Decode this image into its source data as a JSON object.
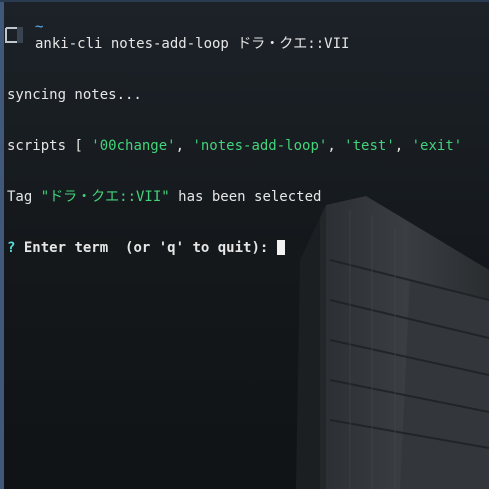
{
  "prompt": {
    "dir": "~",
    "command": "anki-cli notes-add-loop ドラ・クエ::VII"
  },
  "output": {
    "syncing": "syncing notes...",
    "scripts_prefix": "scripts [ ",
    "scripts": [
      "'00change'",
      "'notes-add-loop'",
      "'test'",
      "'exit'"
    ],
    "tag_prefix": "Tag ",
    "tag_name": "\"ドラ・クエ::VII\"",
    "tag_suffix": " has been selected",
    "question_mark": "?",
    "question_text": "Enter term  (or 'q' to quit):"
  },
  "colors": {
    "accent_green": "#43d37a",
    "prompt_blue": "#5fb0f0",
    "question_cyan": "#59d8d8"
  }
}
